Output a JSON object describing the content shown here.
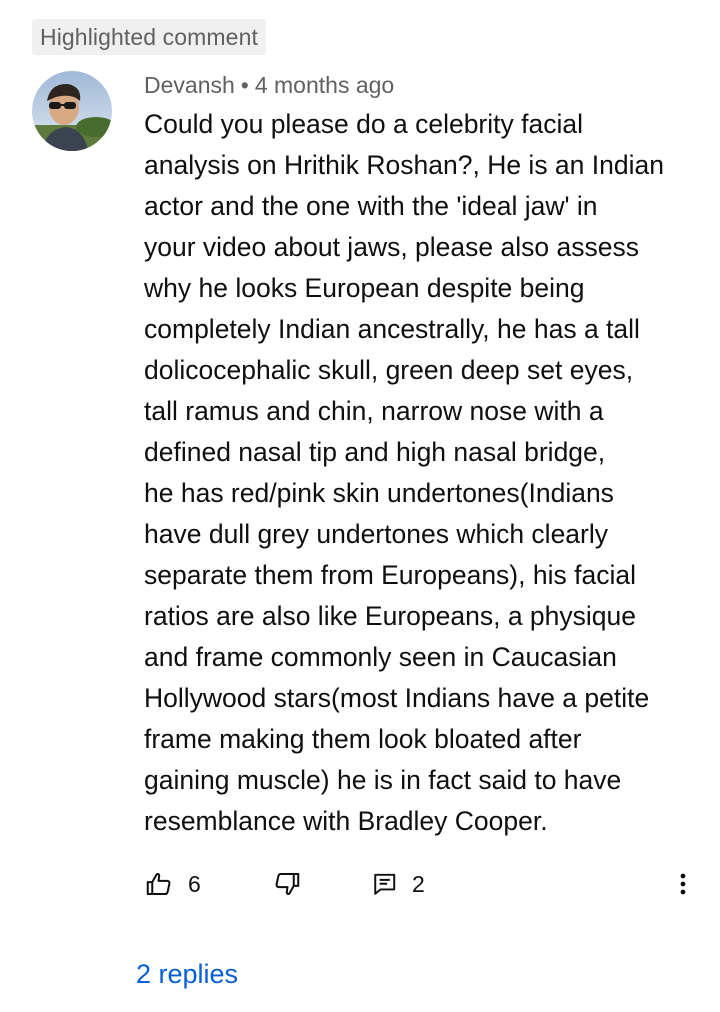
{
  "badge": {
    "label": "Highlighted comment"
  },
  "comment": {
    "author": "Devansh",
    "separator": "•",
    "time": "4 months ago",
    "lines": [
      "Could you please do a celebrity facial",
      "analysis on Hrithik Roshan?, He is an Indian",
      "actor and the one with the 'ideal jaw' in",
      "your video about jaws, please also assess",
      "why he looks European despite being",
      "completely Indian ancestrally, he has a tall",
      "dolicocephalic skull, green deep set eyes,",
      "tall ramus and chin, narrow nose with a",
      "defined nasal tip and high nasal bridge,",
      "he has red/pink skin undertones(Indians",
      "have dull grey undertones which clearly",
      "separate them from Europeans), his facial",
      "ratios are also like Europeans, a physique",
      "and frame commonly seen in Caucasian",
      "Hollywood stars(most Indians have a petite",
      "frame making them look bloated after",
      "gaining muscle) he is in fact said to have",
      "resemblance with Bradley Cooper."
    ]
  },
  "actions": {
    "like_icon": "thumb-up-icon",
    "like_count": "6",
    "dislike_icon": "thumb-down-icon",
    "reply_icon": "comment-icon",
    "reply_count": "2",
    "more_icon": "more-vert-icon"
  },
  "replies": {
    "label": "2 replies"
  },
  "colors": {
    "text": "#0f0f0f",
    "secondary": "#606060",
    "link": "#065fd4",
    "badge_bg": "#f0f0f0"
  }
}
